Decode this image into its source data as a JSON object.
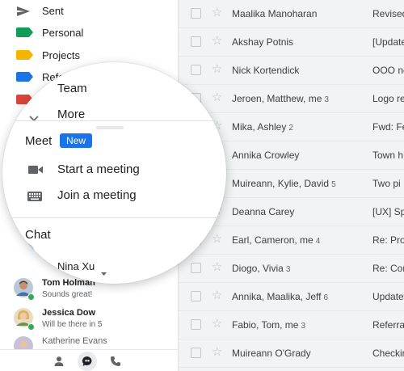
{
  "sidebar": {
    "nav_items": [
      {
        "label": "Sent",
        "icon": "send-icon"
      },
      {
        "label": "Personal",
        "icon": "label-icon",
        "color": "#0f9d58"
      },
      {
        "label": "Projects",
        "icon": "label-icon",
        "color": "#f4b400"
      },
      {
        "label": "Reference",
        "icon": "label-icon",
        "color": "#1a73e8"
      },
      {
        "label": "",
        "icon": "label-icon",
        "color": "#db4437"
      }
    ],
    "chats": [
      {
        "name": "Tom Holman",
        "status": "Sounds great!"
      },
      {
        "name": "Jessica Dow",
        "status": "Will be there in 5"
      },
      {
        "name": "Katherine Evans",
        "status": ""
      }
    ],
    "bottom_icons": [
      "person-icon",
      "chat-icon",
      "phone-icon"
    ]
  },
  "magnifier": {
    "team_label": "Team",
    "more_label": "More",
    "meet_title": "Meet",
    "meet_badge": "New",
    "start_meeting": "Start a meeting",
    "join_meeting": "Join a meeting",
    "chat_title": "Chat",
    "user_name": "Nina Xu"
  },
  "mail": {
    "rows": [
      {
        "sender": "Maalika Manoharan",
        "count": "",
        "subject": "Revised"
      },
      {
        "sender": "Akshay Potnis",
        "count": "",
        "subject": "[Update"
      },
      {
        "sender": "Nick Kortendick",
        "count": "",
        "subject": "OOO ne"
      },
      {
        "sender": "Jeroen, Matthew, me",
        "count": "3",
        "subject": "Logo re"
      },
      {
        "sender": "Mika, Ashley",
        "count": "2",
        "subject": "Fwd: Fe"
      },
      {
        "sender": "Annika Crowley",
        "count": "",
        "subject": "Town h"
      },
      {
        "sender": "Muireann, Kylie, David",
        "count": "5",
        "subject": "Two pi"
      },
      {
        "sender": "Deanna Carey",
        "count": "",
        "subject": "[UX] Sp"
      },
      {
        "sender": "Earl, Cameron, me",
        "count": "4",
        "subject": "Re: Pro"
      },
      {
        "sender": "Diogo, Vivia",
        "count": "3",
        "subject": "Re: Con"
      },
      {
        "sender": "Annika, Maalika, Jeff",
        "count": "6",
        "subject": "Update"
      },
      {
        "sender": "Fabio, Tom, me",
        "count": "3",
        "subject": "Referra"
      },
      {
        "sender": "Muireann O'Grady",
        "count": "",
        "subject": "Checkin"
      }
    ]
  },
  "colors": {
    "accent": "#1a73e8",
    "online": "#34a853",
    "mail_bg": "#f1f3f4"
  }
}
